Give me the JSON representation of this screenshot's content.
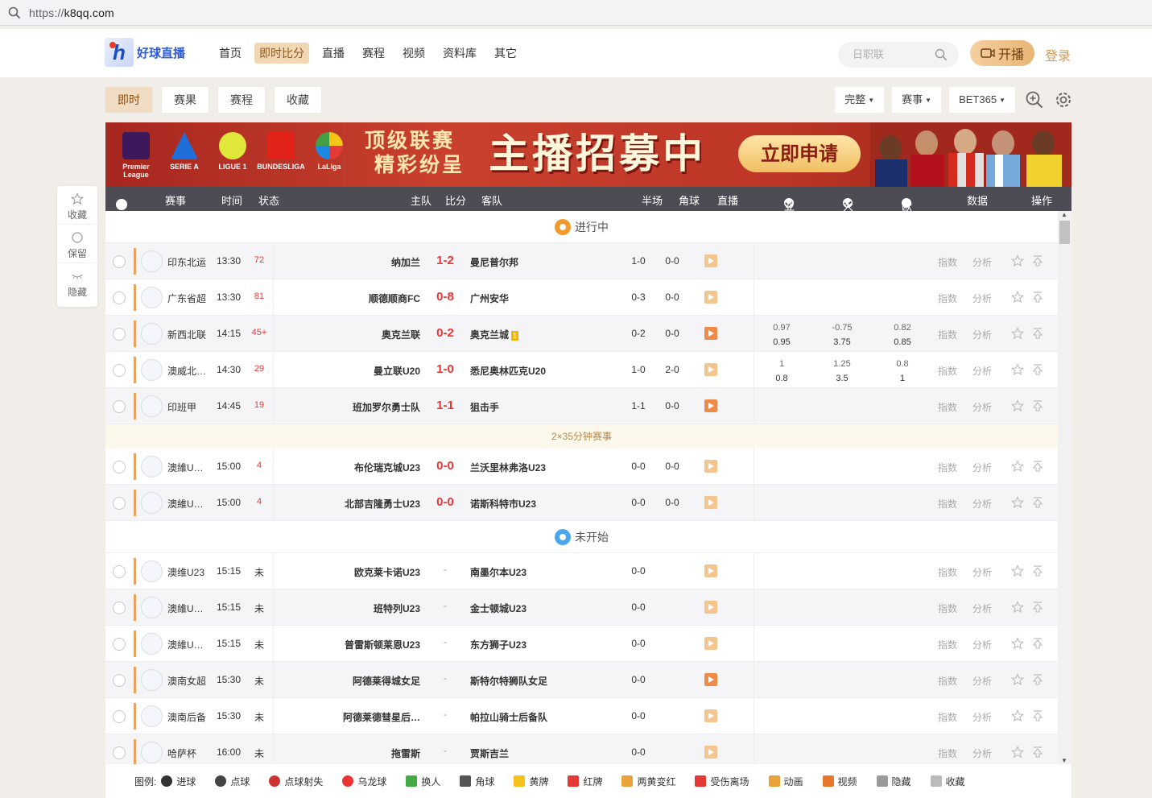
{
  "browser": {
    "url_scheme": "https://",
    "url_host": "k8qq.com"
  },
  "header": {
    "logo_text": "好球直播",
    "nav": [
      "首页",
      "即时比分",
      "直播",
      "赛程",
      "视频",
      "资料库",
      "其它"
    ],
    "search_placeholder": "日职联",
    "live_button": "开播",
    "login": "登录"
  },
  "tabs": [
    "即时",
    "赛果",
    "赛程",
    "收藏"
  ],
  "filters": [
    "完整",
    "赛事",
    "BET365"
  ],
  "banner": {
    "leagues": [
      "Premier League",
      "SERIE A",
      "LIGUE 1",
      "BUNDESLIGA",
      "LaLiga"
    ],
    "slogan_line1": "顶级联赛",
    "slogan_line2": "精彩纷呈",
    "headline": "主播招募中",
    "apply": "立即申请"
  },
  "sidepanel": [
    "收藏",
    "保留",
    "隐藏"
  ],
  "table_head": {
    "event": "赛事",
    "time": "时间",
    "status": "状态",
    "home": "主队",
    "score": "比分",
    "away": "客队",
    "half": "半场",
    "corner": "角球",
    "live": "直播",
    "asia": "亚",
    "big": "大",
    "euro": "欧",
    "data": "数据",
    "ops": "操作"
  },
  "sections": {
    "live": "进行中",
    "upcoming": "未开始",
    "note": "2×35分钟赛事"
  },
  "row_actions": {
    "index": "指数",
    "analysis": "分析"
  },
  "live_rows": [
    {
      "league": "印东北运",
      "time": "13:30",
      "min": "72",
      "home": "纳加兰",
      "score": "1-2",
      "away": "曼尼普尔邦",
      "half": "1-0",
      "corner": "0-0",
      "live": false,
      "odds": null
    },
    {
      "league": "广东省超",
      "time": "13:30",
      "min": "81",
      "home": "顺德顺商FC",
      "score": "0-8",
      "away": "广州安华",
      "half": "0-3",
      "corner": "0-0",
      "live": false,
      "odds": null
    },
    {
      "league": "新西北联",
      "time": "14:15",
      "min": "45+",
      "home": "奥克兰联",
      "score": "0-2",
      "away": "奥克兰城",
      "yellow": "1",
      "half": "0-2",
      "corner": "0-0",
      "live": true,
      "odds": [
        [
          "0.97",
          "0.95"
        ],
        [
          "-0.75",
          "3.75"
        ],
        [
          "0.82",
          "0.85"
        ]
      ]
    },
    {
      "league": "澳威北…",
      "time": "14:30",
      "min": "29",
      "home": "曼立联U20",
      "score": "1-0",
      "away": "悉尼奥林匹克U20",
      "half": "1-0",
      "corner": "2-0",
      "live": false,
      "odds": [
        [
          "1",
          "0.8"
        ],
        [
          "1.25",
          "3.5"
        ],
        [
          "0.8",
          "1"
        ]
      ]
    },
    {
      "league": "印班甲",
      "time": "14:45",
      "min": "19",
      "home": "班加罗尔勇士队",
      "score": "1-1",
      "away": "狙击手",
      "half": "1-1",
      "corner": "0-0",
      "live": true,
      "odds": null
    }
  ],
  "live_rows2": [
    {
      "league": "澳維U…",
      "time": "15:00",
      "min": "4",
      "home": "布伦瑞克城U23",
      "score": "0-0",
      "away": "兰沃里林弗洛U23",
      "half": "0-0",
      "corner": "0-0",
      "live": false
    },
    {
      "league": "澳維U…",
      "time": "15:00",
      "min": "4",
      "home": "北部吉隆勇士U23",
      "score": "0-0",
      "away": "诺斯科特市U23",
      "half": "0-0",
      "corner": "0-0",
      "live": false
    }
  ],
  "upcoming_rows": [
    {
      "league": "澳维U23",
      "time": "15:15",
      "min": "未",
      "home": "欧克莱卡诺U23",
      "score": "-",
      "away": "南墨尔本U23",
      "half": "0-0",
      "live": false
    },
    {
      "league": "澳維U…",
      "time": "15:15",
      "min": "未",
      "home": "班特列U23",
      "score": "-",
      "away": "金士顿城U23",
      "half": "0-0",
      "live": false
    },
    {
      "league": "澳維U…",
      "time": "15:15",
      "min": "未",
      "home": "普雷斯顿莱恩U23",
      "score": "-",
      "away": "东方狮子U23",
      "half": "0-0",
      "live": false
    },
    {
      "league": "澳南女超",
      "time": "15:30",
      "min": "未",
      "home": "阿德莱得城女足",
      "score": "-",
      "away": "斯特尔特狮队女足",
      "half": "0-0",
      "live": true
    },
    {
      "league": "澳南后备",
      "time": "15:30",
      "min": "未",
      "home": "阿德莱德彗星后…",
      "score": "-",
      "away": "帕拉山骑士后备队",
      "half": "0-0",
      "live": false
    },
    {
      "league": "哈萨杯",
      "time": "16:00",
      "min": "未",
      "home": "拖雷斯",
      "score": "-",
      "away": "贾斯吉兰",
      "half": "0-0",
      "live": false
    }
  ],
  "legend": {
    "label": "图例:",
    "items": [
      "进球",
      "点球",
      "点球射失",
      "乌龙球",
      "换人",
      "角球",
      "黄牌",
      "红牌",
      "两黄变红",
      "受伤离场",
      "动画",
      "视频",
      "隐藏",
      "收藏"
    ]
  },
  "colors": {
    "accent": "#e6a25e",
    "score_red": "#e33333",
    "header_dark": "#4d4c54",
    "banner_red": "#c9402e"
  }
}
